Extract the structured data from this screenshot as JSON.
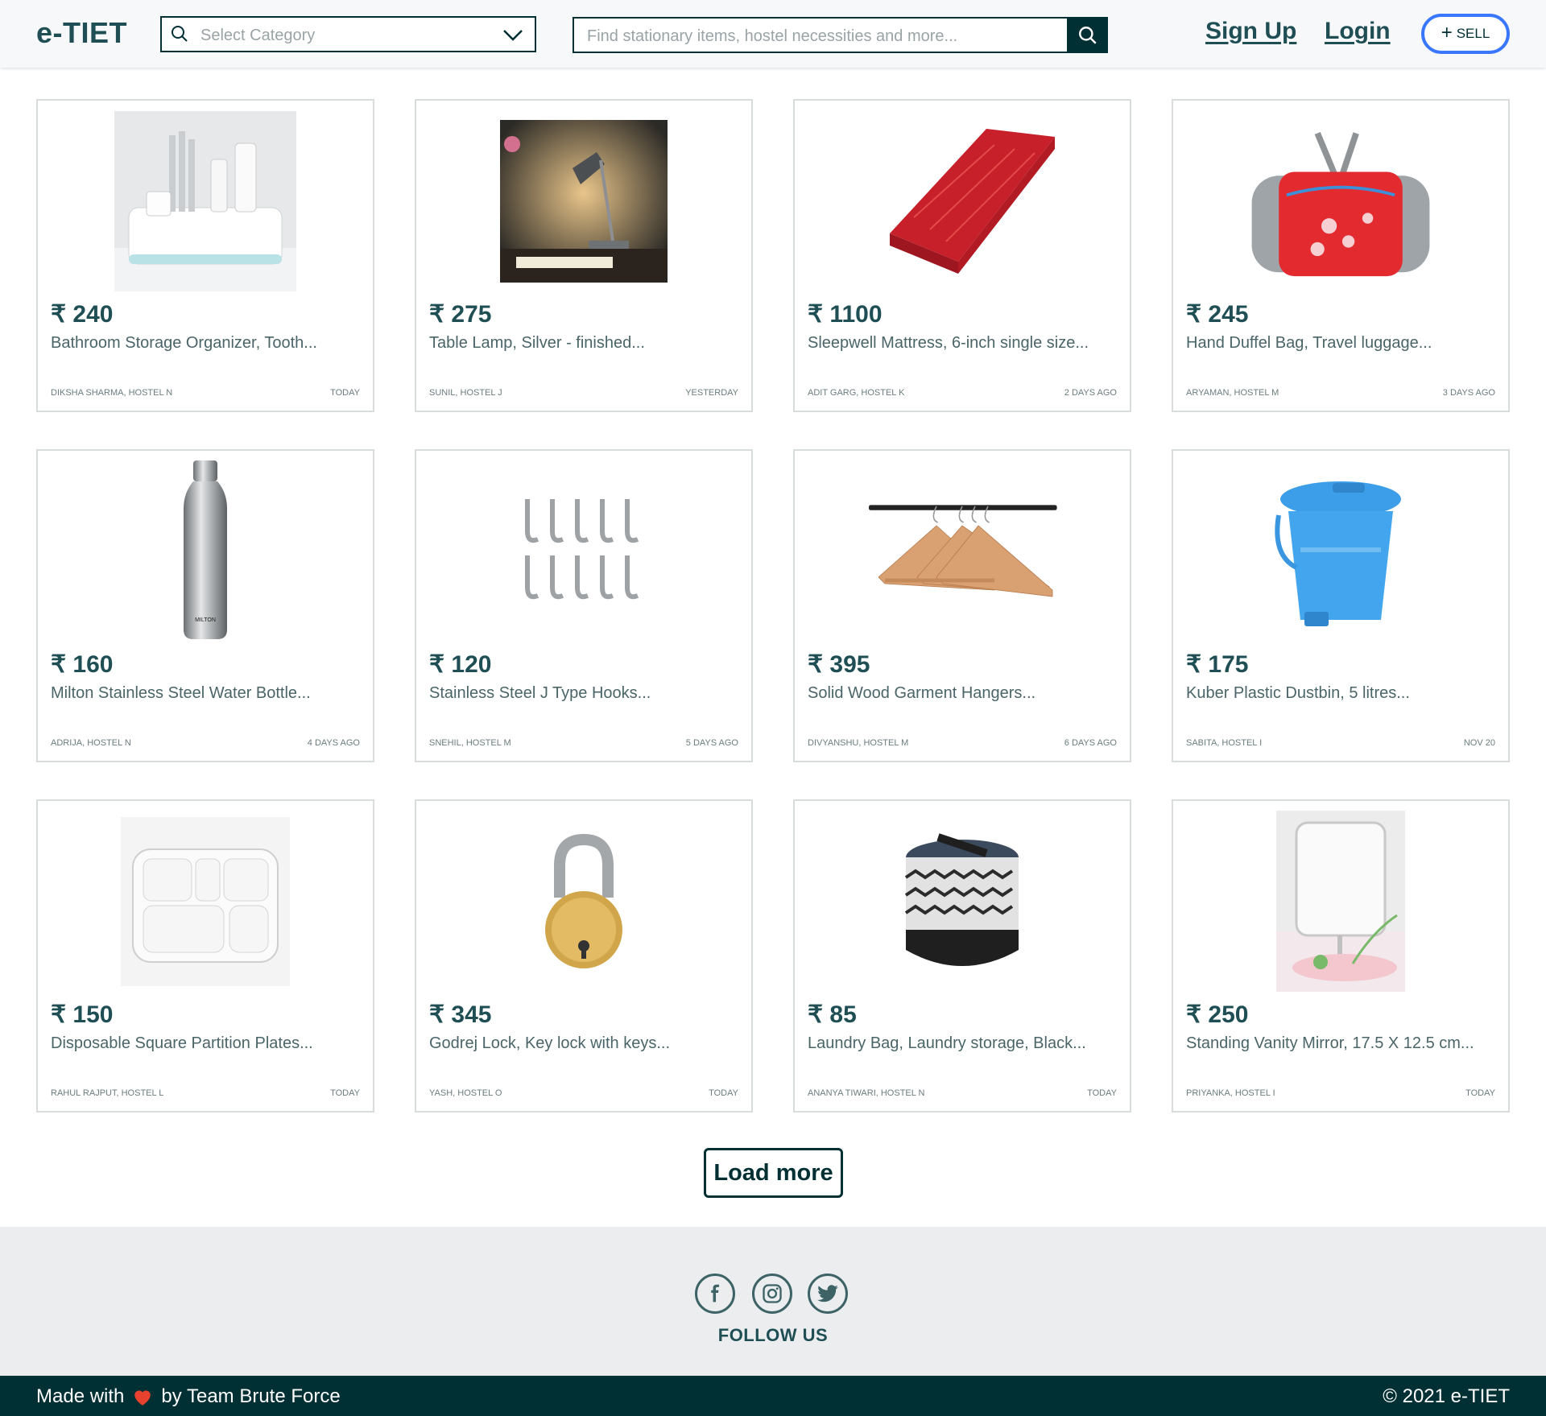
{
  "header": {
    "logo": "e-TIET",
    "category_placeholder": "Select Category",
    "search_placeholder": "Find stationary items, hostel necessities and more...",
    "signup": "Sign Up",
    "login": "Login",
    "sell": "SELL"
  },
  "products": [
    {
      "price": "₹ 240",
      "title": "Bathroom Storage Organizer, Tooth...",
      "seller": "DIKSHA SHARMA, HOSTEL N",
      "date": "TODAY",
      "icon": "organizer-image"
    },
    {
      "price": "₹ 275",
      "title": "Table Lamp, Silver - finished...",
      "seller": "SUNIL, HOSTEL J",
      "date": "YESTERDAY",
      "icon": "lamp-image"
    },
    {
      "price": "₹ 1100",
      "title": "Sleepwell Mattress, 6-inch single size...",
      "seller": "ADIT GARG, HOSTEL K",
      "date": "2 DAYS AGO",
      "icon": "mattress-image"
    },
    {
      "price": "₹ 245",
      "title": "Hand Duffel Bag, Travel luggage...",
      "seller": "ARYAMAN, HOSTEL M",
      "date": "3 DAYS AGO",
      "icon": "duffel-bag-image"
    },
    {
      "price": "₹ 160",
      "title": "Milton Stainless Steel Water Bottle...",
      "seller": "ADRIJA, HOSTEL N",
      "date": "4 DAYS AGO",
      "icon": "bottle-image"
    },
    {
      "price": "₹ 120",
      "title": "Stainless Steel J Type Hooks...",
      "seller": "SNEHIL, HOSTEL M",
      "date": "5 DAYS AGO",
      "icon": "hooks-image"
    },
    {
      "price": "₹ 395",
      "title": "Solid Wood Garment Hangers...",
      "seller": "DIVYANSHU, HOSTEL M",
      "date": "6 DAYS AGO",
      "icon": "hangers-image"
    },
    {
      "price": "₹ 175",
      "title": "Kuber Plastic Dustbin, 5 litres...",
      "seller": "SABITA, HOSTEL I",
      "date": "NOV 20",
      "icon": "dustbin-image"
    },
    {
      "price": "₹ 150",
      "title": "Disposable Square Partition Plates...",
      "seller": "RAHUL RAJPUT, HOSTEL L",
      "date": "TODAY",
      "icon": "plate-image"
    },
    {
      "price": "₹ 345",
      "title": "Godrej Lock, Key lock with keys...",
      "seller": "YASH, HOSTEL O",
      "date": "TODAY",
      "icon": "padlock-image"
    },
    {
      "price": "₹ 85",
      "title": "Laundry Bag, Laundry storage, Black...",
      "seller": "ANANYA TIWARI, HOSTEL N",
      "date": "TODAY",
      "icon": "laundry-bag-image"
    },
    {
      "price": "₹ 250",
      "title": "Standing Vanity Mirror, 17.5 X 12.5 cm...",
      "seller": "PRIYANKA, HOSTEL I",
      "date": "TODAY",
      "icon": "mirror-image"
    }
  ],
  "load_more": "Load more",
  "footer": {
    "follow": "FOLLOW US",
    "made_with": "Made with",
    "by": "by Team Brute Force",
    "copyright": "© 2021 e-TIET",
    "socials": [
      "facebook-icon",
      "instagram-icon",
      "twitter-icon"
    ]
  },
  "colors": {
    "primary": "#002f34",
    "accent": "#3a77ff",
    "heart": "#e8412e"
  }
}
